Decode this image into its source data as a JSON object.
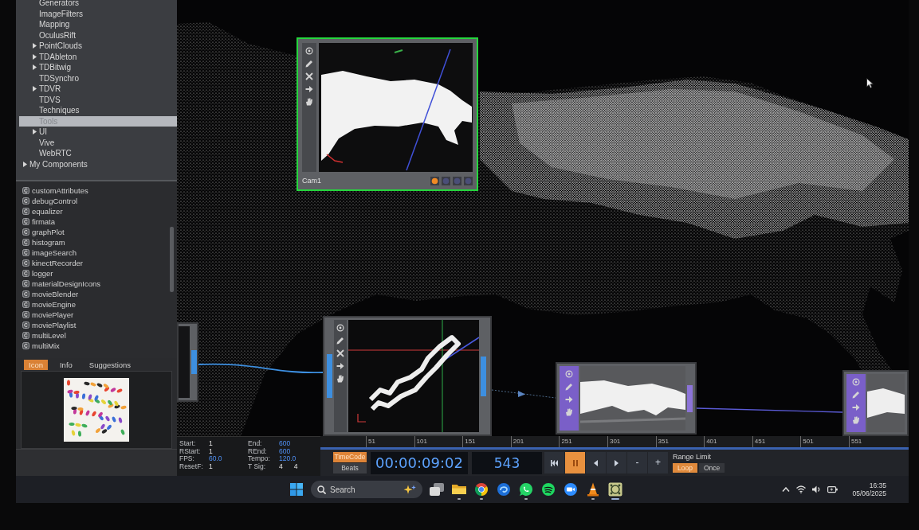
{
  "palette": {
    "tree": [
      {
        "children": [
          {
            "label": "Generators",
            "expandable": false,
            "selected": false
          },
          {
            "label": "ImageFilters",
            "expandable": false,
            "selected": false
          },
          {
            "label": "Mapping",
            "expandable": false,
            "selected": false
          },
          {
            "label": "OculusRift",
            "expandable": false,
            "selected": false
          },
          {
            "label": "PointClouds",
            "expandable": true,
            "selected": false
          },
          {
            "label": "TDAbleton",
            "expandable": true,
            "selected": false
          },
          {
            "label": "TDBitwig",
            "expandable": true,
            "selected": false
          },
          {
            "label": "TDSynchro",
            "expandable": false,
            "selected": false
          },
          {
            "label": "TDVR",
            "expandable": true,
            "selected": false
          },
          {
            "label": "TDVS",
            "expandable": false,
            "selected": false
          },
          {
            "label": "Techniques",
            "expandable": false,
            "selected": false
          },
          {
            "label": "Tools",
            "expandable": false,
            "selected": true
          },
          {
            "label": "UI",
            "expandable": true,
            "selected": false
          },
          {
            "label": "Vive",
            "expandable": false,
            "selected": false
          },
          {
            "label": "WebRTC",
            "expandable": false,
            "selected": false
          }
        ]
      },
      {
        "label": "My Components",
        "expandable": true,
        "selected": false
      }
    ],
    "components": [
      "customAttributes",
      "debugControl",
      "equalizer",
      "firmata",
      "graphPlot",
      "histogram",
      "imageSearch",
      "kinectRecorder",
      "logger",
      "materialDesignIcons",
      "movieBlender",
      "movieEngine",
      "moviePlayer",
      "moviePlaylist",
      "multiLevel",
      "multiMix"
    ],
    "info_tabs": [
      {
        "label": "Icon",
        "selected": true
      },
      {
        "label": "Info",
        "selected": false
      },
      {
        "label": "Suggestions",
        "selected": false
      }
    ]
  },
  "network": {
    "nodes": [
      {
        "kind": "viewer3d",
        "label": "Cam1",
        "selected": true,
        "flags": [
          {
            "on": true
          },
          {
            "on": false
          },
          {
            "on": false
          },
          {
            "on": false
          }
        ]
      },
      {
        "kind": "partial",
        "selected": false
      },
      {
        "kind": "viewer3d",
        "selected": false
      },
      {
        "kind": "top",
        "selected": false
      },
      {
        "kind": "top",
        "selected": false
      }
    ]
  },
  "timeline": {
    "settings": [
      {
        "label": "Start:",
        "value": "1",
        "modified": false
      },
      {
        "label": "End:",
        "value": "600",
        "modified": true
      },
      {
        "label": "RStart:",
        "value": "1",
        "modified": false
      },
      {
        "label": "REnd:",
        "value": "600",
        "modified": true
      },
      {
        "label": "FPS:",
        "value": "60.0",
        "modified": true
      },
      {
        "label": "Tempo:",
        "value": "120.0",
        "modified": true
      },
      {
        "label": "ResetF:",
        "value": "1",
        "modified": false
      },
      {
        "label": "T Sig:",
        "value": "4",
        "value_2": "4",
        "modified": false
      }
    ],
    "ruler_ticks": [
      "51",
      "101",
      "151",
      "201",
      "251",
      "301",
      "351",
      "401",
      "451",
      "501",
      "551"
    ],
    "time_modes": [
      {
        "label": "TimeCode",
        "selected": true
      },
      {
        "label": "Beats",
        "selected": false
      }
    ],
    "timecode": "00:00:09:02",
    "frame": "543",
    "transport": [
      {
        "kind": "skip_start",
        "active": false
      },
      {
        "kind": "pause",
        "active": true
      },
      {
        "kind": "step_back",
        "active": false
      },
      {
        "kind": "step_forward",
        "active": false
      },
      {
        "kind": "text",
        "label": "-",
        "active": false
      },
      {
        "kind": "text",
        "label": "+",
        "active": false
      }
    ],
    "range_limit": {
      "label": "Range Limit",
      "options": [
        {
          "label": "Loop",
          "selected": true
        },
        {
          "label": "Once",
          "selected": false
        }
      ]
    }
  },
  "taskbar": {
    "search": {
      "placeholder": "Search"
    },
    "apps": [
      {
        "kind": "task_view",
        "running": false,
        "active": false
      },
      {
        "kind": "folder",
        "running": true,
        "active": false
      },
      {
        "kind": "browser",
        "running": true,
        "active": false
      },
      {
        "kind": "swirl",
        "running": false,
        "active": false
      },
      {
        "kind": "chat",
        "running": true,
        "active": false
      },
      {
        "kind": "music",
        "running": false,
        "active": false
      },
      {
        "kind": "meeting",
        "running": false,
        "active": false
      },
      {
        "kind": "cone",
        "running": true,
        "active": false
      },
      {
        "kind": "grid",
        "running": true,
        "active": true
      }
    ],
    "time": "16:35",
    "date": "05/06/2025"
  }
}
